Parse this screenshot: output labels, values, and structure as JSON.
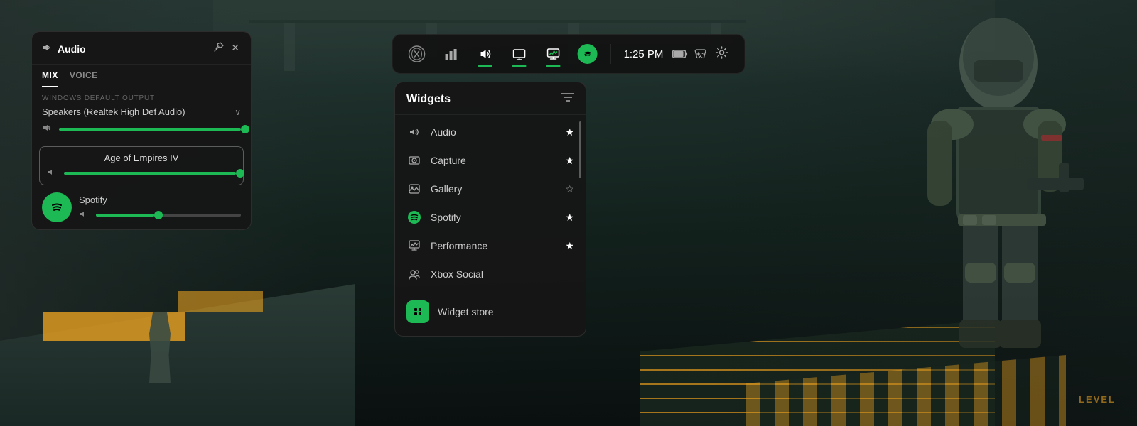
{
  "background": {
    "color": "#1a2a25"
  },
  "gamebar": {
    "time": "1:25 PM",
    "buttons": [
      {
        "id": "xbox",
        "icon": "⊞",
        "label": "Xbox",
        "active": false,
        "underline": false
      },
      {
        "id": "capture",
        "icon": "📊",
        "label": "Capture Stats",
        "active": false,
        "underline": false
      },
      {
        "id": "volume",
        "icon": "🔊",
        "label": "Audio",
        "active": true,
        "underline": true
      },
      {
        "id": "screen",
        "icon": "⬜",
        "label": "Screen",
        "active": true,
        "underline": true
      },
      {
        "id": "monitor",
        "icon": "🖥",
        "label": "Performance",
        "active": true,
        "underline": true
      },
      {
        "id": "spotify",
        "icon": "●",
        "label": "Spotify",
        "active": false,
        "underline": false
      }
    ],
    "settings_icon": "⚙",
    "battery_icon": "🔋",
    "controller_icon": "🎮"
  },
  "audio_panel": {
    "title": "Audio",
    "title_icon": "🔊",
    "tabs": [
      {
        "id": "mix",
        "label": "MIX",
        "active": true
      },
      {
        "id": "voice",
        "label": "VOICE",
        "active": false
      }
    ],
    "output_label": "WINDOWS DEFAULT OUTPUT",
    "speaker_name": "Speakers (Realtek High Def Audio)",
    "speaker_volume": 100,
    "app_items": [
      {
        "id": "age_of_empires",
        "name": "Age of Empires IV",
        "volume": 100,
        "has_border": true
      },
      {
        "id": "spotify",
        "name": "Spotify",
        "volume": 40,
        "has_spotify_icon": true
      }
    ],
    "close_icon": "✕",
    "pin_icon": "✱"
  },
  "widgets_panel": {
    "title": "Widgets",
    "filter_icon": "≡",
    "items": [
      {
        "id": "audio",
        "label": "Audio",
        "icon": "volume",
        "starred": true
      },
      {
        "id": "capture",
        "label": "Capture",
        "icon": "capture",
        "starred": true
      },
      {
        "id": "gallery",
        "label": "Gallery",
        "icon": "gallery",
        "starred": false
      },
      {
        "id": "spotify",
        "label": "Spotify",
        "icon": "spotify",
        "starred": true
      },
      {
        "id": "performance",
        "label": "Performance",
        "icon": "performance",
        "starred": true
      },
      {
        "id": "xbox_social",
        "label": "Xbox Social",
        "icon": "social",
        "starred": false
      }
    ],
    "store": {
      "label": "Widget store",
      "icon": "store"
    }
  }
}
